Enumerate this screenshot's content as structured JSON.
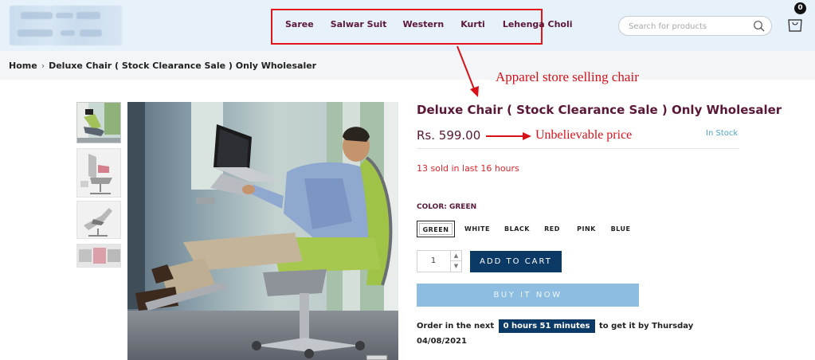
{
  "header": {
    "nav_items": [
      "Saree",
      "Salwar Suit",
      "Western",
      "Kurti",
      "Lehenga Choli"
    ],
    "search_placeholder": "Search for products",
    "cart_count": "0"
  },
  "breadcrumb": {
    "home": "Home",
    "separator": "›",
    "current": "Deluxe Chair ( Stock Clearance Sale ) Only Wholesaler"
  },
  "annotations": {
    "store": "Apparel store selling chair",
    "price": "Unbelievable price",
    "color": "#d8101a"
  },
  "product": {
    "title": "Deluxe Chair ( Stock Clearance Sale ) Only Wholesaler",
    "price": "Rs. 599.00",
    "stock": "In Stock",
    "sold": "13 sold in last 16 hours",
    "color_label": "COLOR: GREEN",
    "colors": [
      "GREEN",
      "WHITE",
      "BLACK",
      "RED",
      "PINK",
      "BLUE"
    ],
    "selected_color": "GREEN",
    "quantity": "1",
    "add_to_cart": "ADD TO CART",
    "buy_now": "BUY IT NOW",
    "order_prefix": "Order in the next",
    "order_timer": "0 hours 51 minutes",
    "order_suffix": "to get it by Thursday 04/08/2021"
  },
  "colors": {
    "brand": "#5a1738",
    "primary_button": "#0b3a66",
    "secondary_button": "#8dbee2",
    "stock": "#4ea6c8",
    "alert": "#e0232b",
    "header_bg": "#e7f1f9"
  },
  "icons": [
    "search-icon",
    "cart-icon",
    "chevron-right-icon",
    "arrow-down-right-icon",
    "arrow-right-icon"
  ]
}
